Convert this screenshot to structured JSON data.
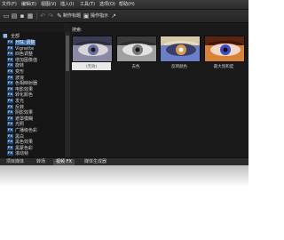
{
  "menu": [
    {
      "label": "文件(F)"
    },
    {
      "label": "编辑(E)"
    },
    {
      "label": "视图(V)"
    },
    {
      "label": "插入(I)"
    },
    {
      "label": "工具(T)"
    },
    {
      "label": "选项(O)"
    },
    {
      "label": "帮助(H)"
    }
  ],
  "toolbar": {
    "create_title_label": "制作标题",
    "operation_wizard_label": "操作指示"
  },
  "tree": {
    "root_label": "全部",
    "items": [
      "HSL 调整",
      "Vignette",
      "四色调整",
      "增加图像值",
      "旋转",
      "变形",
      "波浪",
      "色相映射器",
      "电影效果",
      "转化颜色",
      "发光",
      "反转",
      "阴影效果",
      "遮罩模糊",
      "光照",
      "广播级色彩",
      "黑白",
      "黑色效果",
      "黑蒙色彩",
      "滚动帧"
    ],
    "selected_index": 0
  },
  "search": {
    "label": "搜索:"
  },
  "thumbnails": [
    {
      "label": "(无效)",
      "selected": true
    },
    {
      "label": "去色",
      "selected": false
    },
    {
      "label": "反转颜色",
      "selected": false
    },
    {
      "label": "最大饱和度",
      "selected": false
    }
  ],
  "tabs": [
    {
      "label": "项目媒体",
      "active": false
    },
    {
      "label": "转场",
      "active": false
    },
    {
      "label": "视频 FX",
      "active": true
    },
    {
      "label": "媒体生成器",
      "active": false
    }
  ],
  "colors": {
    "window_bg": "#1f1f1f",
    "selection": "#3a6fb0",
    "fx_badge": "#214a7a"
  }
}
